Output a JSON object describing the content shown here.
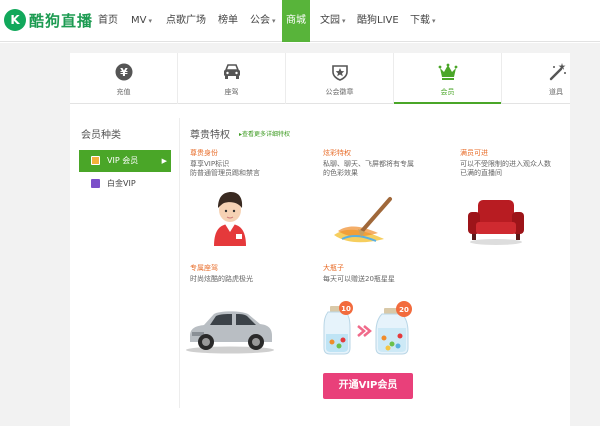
{
  "brand": {
    "logo_glyph": "K",
    "name": "酷狗直播"
  },
  "nav": {
    "items": [
      {
        "label": "首页"
      },
      {
        "label": "MV",
        "has_caret": true
      },
      {
        "label": "点歌广场"
      },
      {
        "label": "榜单"
      },
      {
        "label": "公会",
        "has_caret": true
      },
      {
        "label": "商城",
        "active": true
      },
      {
        "label": "文园",
        "has_caret": true
      },
      {
        "label": "酷狗LIVE"
      },
      {
        "label": "下载",
        "has_caret": true
      }
    ],
    "caret_glyph": "▾"
  },
  "category_tabs": [
    {
      "label": "充值",
      "icon": "yen-coin-icon"
    },
    {
      "label": "座驾",
      "icon": "car-icon"
    },
    {
      "label": "公会徽章",
      "icon": "badge-medal-icon"
    },
    {
      "label": "会员",
      "icon": "crown-icon",
      "active": true
    },
    {
      "label": "道具",
      "icon": "magic-wand-icon"
    }
  ],
  "sidebar": {
    "title": "会员种类",
    "items": [
      {
        "label": "VIP 会员",
        "active": true,
        "badge_color": "#f3b23a",
        "arrow": "▶"
      },
      {
        "label": "白金VIP",
        "badge_color": "#7b4fc9"
      }
    ]
  },
  "privileges": {
    "title": "尊贵特权",
    "more_link": "▸查看更多详细特权",
    "features": [
      {
        "title": "尊贵身份",
        "desc": [
          "尊享VIP标识",
          "防普通管理员踢和禁言"
        ],
        "icon": "avatar-icon"
      },
      {
        "title": "炫彩特权",
        "desc": [
          "私聊、聊天、飞屏都将有专属",
          "的色彩效果"
        ],
        "icon": "brush-icon"
      },
      {
        "title": "满员可进",
        "desc": [
          "可以不受限制的进入观众人数",
          "已满的直播间"
        ],
        "icon": "armchair-icon"
      },
      {
        "title": "专属座驾",
        "desc": [
          "时尚炫酷的路虎极光"
        ],
        "icon": "suv-car-icon"
      },
      {
        "title": "大瓶子",
        "desc": [
          "每天可以赠送20瓶星星"
        ],
        "icon": "star-jar-icon",
        "jar_before": "10",
        "jar_after": "20"
      }
    ]
  },
  "cta": {
    "label": "开通VIP会员"
  },
  "colors": {
    "brand_green": "#4aa628",
    "nav_active": "#58b43a",
    "feature_title": "#e86d2a",
    "cta_pink": "#e9407a"
  }
}
